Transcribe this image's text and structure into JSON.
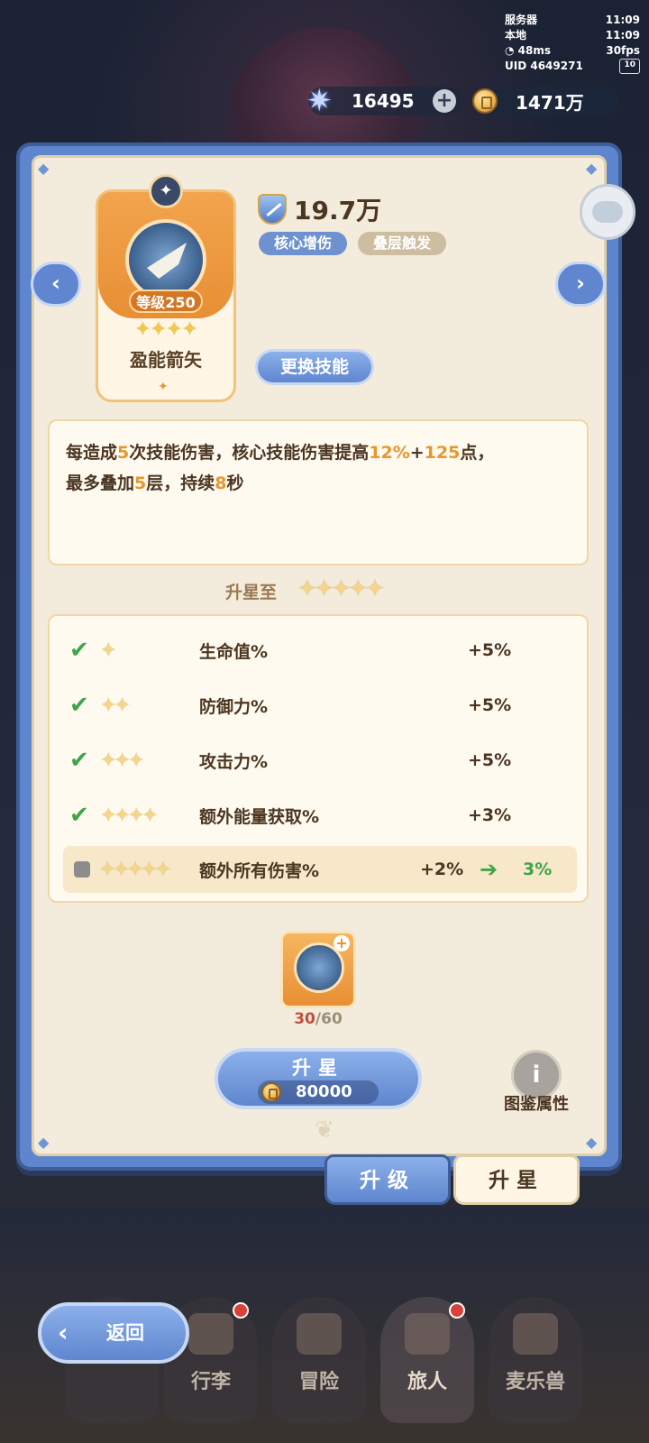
{
  "status": {
    "server_label": "服务器",
    "server_time": "11:09",
    "local_label": "本地",
    "local_time": "11:09",
    "ping": "48ms",
    "fps": "30fps",
    "uid": "UID 4649271",
    "uid_badge": "10"
  },
  "currency": {
    "stars": "16495",
    "gold": "1471万"
  },
  "skill": {
    "level_badge": "等级250",
    "stars": "✦✦✦✦",
    "name": "盈能箭矢",
    "power": "19.7万",
    "tags": [
      "核心增伤",
      "叠层触发"
    ],
    "change_button": "更换技能"
  },
  "description": {
    "p1": "每造成",
    "n1": "5",
    "p2": "次技能伤害，核心技能伤害提高",
    "n2": "12%",
    "p3": "+",
    "n3": "125",
    "p4": "点，",
    "p5": "最多叠加",
    "n4": "5",
    "p6": "层，持续",
    "n5": "8",
    "p7": "秒"
  },
  "upgrade_section": {
    "title": "升星至",
    "target_stars": "✦✦✦✦✦"
  },
  "bonuses": [
    {
      "stars": "✦",
      "label": "生命值%",
      "value": "+5%",
      "done": true
    },
    {
      "stars": "✦✦",
      "label": "防御力%",
      "value": "+5%",
      "done": true
    },
    {
      "stars": "✦✦✦",
      "label": "攻击力%",
      "value": "+5%",
      "done": true
    },
    {
      "stars": "✦✦✦✦",
      "label": "额外能量获取%",
      "value": "+3%",
      "done": true
    },
    {
      "stars": "✦✦✦✦✦",
      "label": "额外所有伤害%",
      "value": "+2%",
      "next": "3%",
      "done": false
    }
  ],
  "material": {
    "have": "30",
    "sep": "/",
    "need": "60"
  },
  "star_button": {
    "label": "升星",
    "cost": "80000"
  },
  "codex_button": "图鉴属性",
  "tabs": {
    "upgrade": "升级",
    "star": "升星"
  },
  "nav": {
    "items": [
      {
        "label": "行李"
      },
      {
        "label": "冒险"
      },
      {
        "label": "旅人"
      },
      {
        "label": "麦乐兽"
      }
    ],
    "back": "返回"
  },
  "colors": {
    "accent_blue": "#5f86cf",
    "highlight_orange": "#e8962e",
    "check_green": "#3fa54a"
  }
}
